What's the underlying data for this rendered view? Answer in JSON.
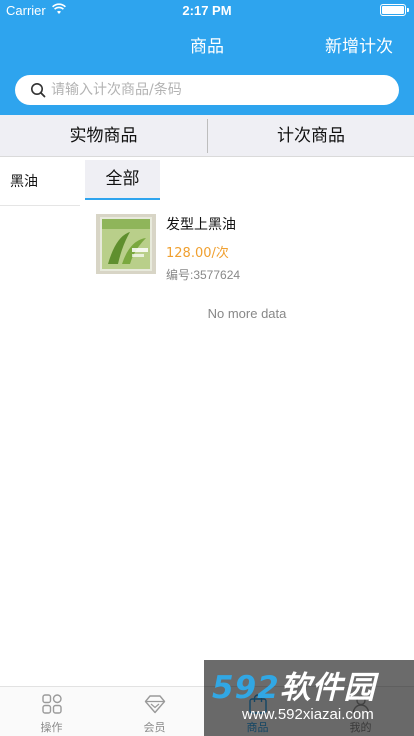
{
  "status_bar": {
    "carrier": "Carrier",
    "time": "2:17 PM",
    "battery_level": 1.0
  },
  "nav": {
    "title": "商品",
    "right_action": "新增计次"
  },
  "search": {
    "placeholder": "请输入计次商品/条码",
    "value": ""
  },
  "tabs": [
    {
      "label": "实物商品"
    },
    {
      "label": "计次商品"
    }
  ],
  "categories": [
    {
      "label": "黑油"
    }
  ],
  "filter": {
    "selected": "全部"
  },
  "products": [
    {
      "name": "发型上黑油",
      "price": "128.00/次",
      "code": "编号:3577624"
    }
  ],
  "list_footer": "No more data",
  "tab_bar": {
    "items": [
      {
        "label": "操作",
        "icon": "grid-icon"
      },
      {
        "label": "会员",
        "icon": "diamond-icon"
      },
      {
        "label": "商品",
        "icon": "goods-icon"
      },
      {
        "label": "我的",
        "icon": "profile-icon"
      }
    ],
    "active_index": 2
  },
  "watermark": {
    "brand_digits": "592",
    "brand_text": "软件园",
    "url": "www.592xiazai.com"
  },
  "colors": {
    "primary": "#2ea4ee",
    "price": "#f0a030",
    "segment_bg": "#efeff4"
  }
}
